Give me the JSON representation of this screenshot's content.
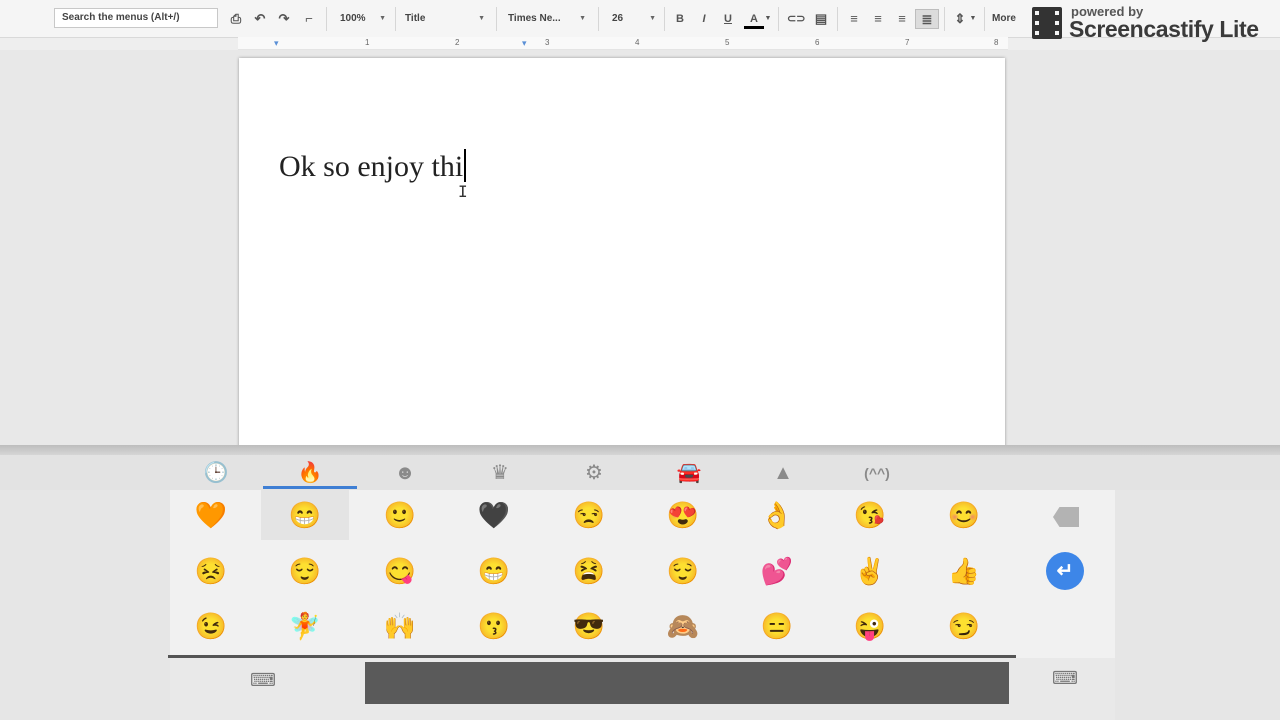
{
  "toolbar": {
    "search_placeholder": "Search the menus (Alt+/)",
    "zoom": "100%",
    "style": "Title",
    "font": "Times Ne...",
    "font_size": "26",
    "more": "More",
    "icons": [
      "print-icon",
      "undo-icon",
      "redo-icon",
      "paint-format-icon",
      "bold-icon",
      "italic-icon",
      "underline-icon",
      "text-color-icon",
      "link-icon",
      "comment-icon",
      "align-left-icon",
      "align-center-icon",
      "align-right-icon",
      "justify-icon",
      "line-spacing-icon"
    ],
    "labels": {
      "bold": "B",
      "italic": "I",
      "underline": "U",
      "text_color": "A"
    }
  },
  "watermark": {
    "powered": "powered by",
    "brand": "Screencastify Lite"
  },
  "ruler": {
    "numbers": [
      "1",
      "2",
      "3",
      "4",
      "5",
      "6",
      "7",
      "8"
    ]
  },
  "document": {
    "text": "Ok so enjoy thi"
  },
  "keyboard": {
    "categories": [
      "recent-icon",
      "fire-icon",
      "face-icon",
      "crown-icon",
      "gear-icon",
      "car-icon",
      "triangle-icon",
      "kaomoji-icon"
    ],
    "kaomoji_label": "(^^)",
    "active_category_index": 1,
    "emoji_rows": [
      [
        "🧡",
        "😁",
        "🙂",
        "🖤",
        "😒",
        "😍",
        "👌",
        "😘",
        "😊"
      ],
      [
        "😣",
        "😌",
        "😋",
        "😁",
        "😫",
        "😌",
        "💕",
        "✌",
        "👍"
      ],
      [
        "😉",
        "🧚",
        "🙌",
        "😗",
        "😎",
        "🙈",
        "😑",
        "😜",
        "😏"
      ]
    ],
    "enter_label": "↵"
  },
  "colors": {
    "accent": "#3f7fd4",
    "enter": "#3d86e8",
    "spacebar": "#5a5a5a"
  }
}
